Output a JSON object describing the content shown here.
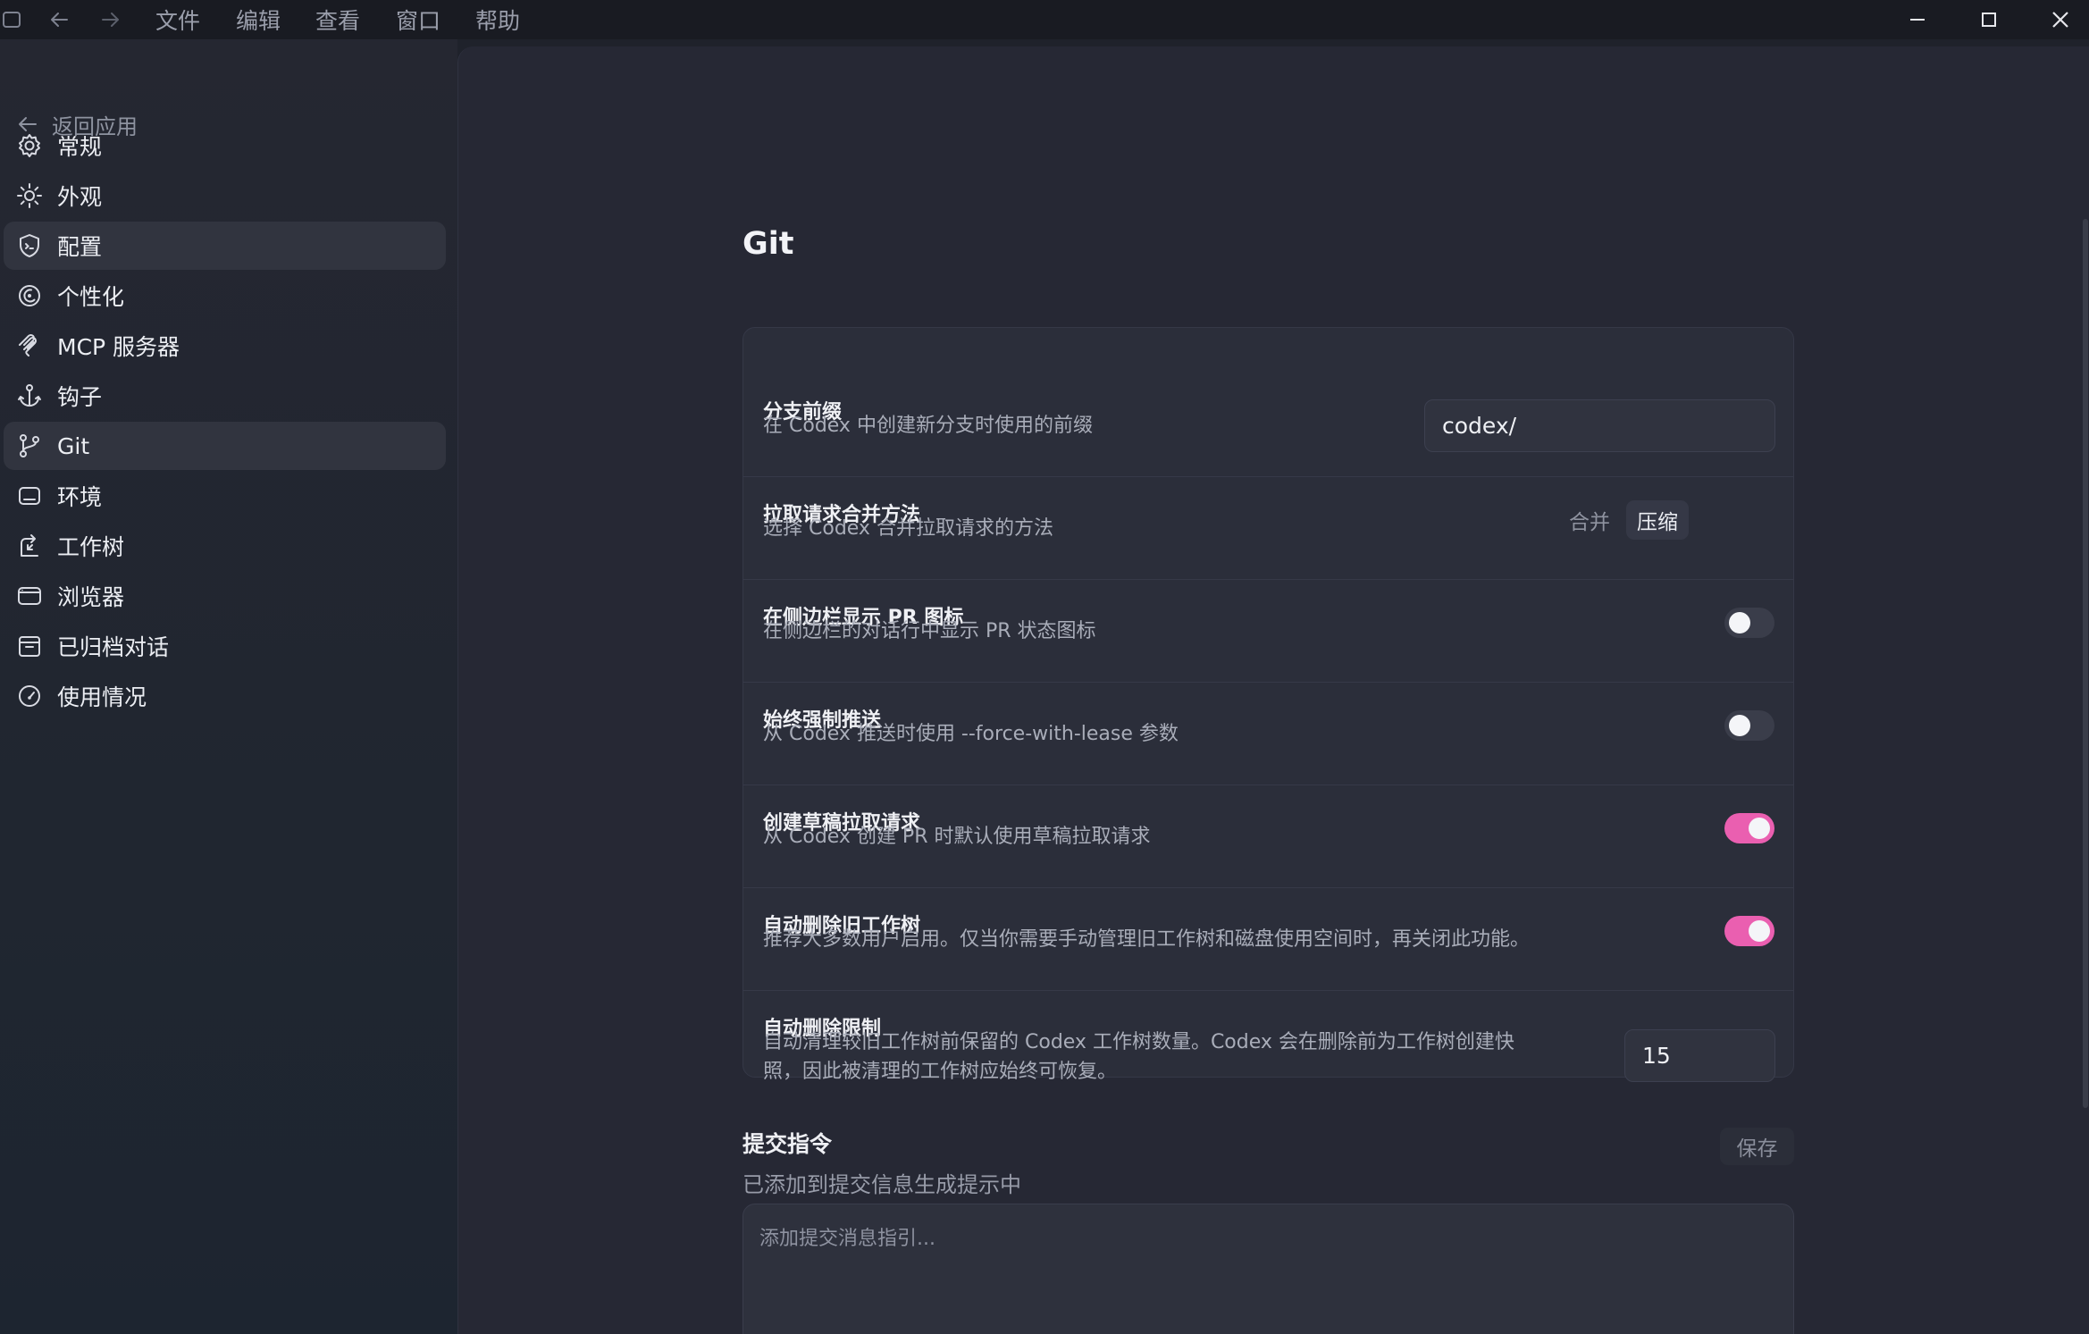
{
  "titlebar": {
    "menus": [
      "文件",
      "编辑",
      "查看",
      "窗口",
      "帮助"
    ]
  },
  "sidebar": {
    "back_label": "返回应用",
    "items": [
      {
        "label": "常规",
        "icon": "gear-icon"
      },
      {
        "label": "外观",
        "icon": "sun-icon"
      },
      {
        "label": "配置",
        "icon": "shield-icon"
      },
      {
        "label": "个性化",
        "icon": "personalize-icon"
      },
      {
        "label": "MCP 服务器",
        "icon": "mcp-icon"
      },
      {
        "label": "钩子",
        "icon": "anchor-icon"
      },
      {
        "label": "Git",
        "icon": "git-branch-icon"
      },
      {
        "label": "环境",
        "icon": "environment-icon"
      },
      {
        "label": "工作树",
        "icon": "worktree-icon"
      },
      {
        "label": "浏览器",
        "icon": "browser-icon"
      },
      {
        "label": "已归档对话",
        "icon": "archive-icon"
      },
      {
        "label": "使用情况",
        "icon": "gauge-icon"
      }
    ],
    "active_items": [
      "配置",
      "Git"
    ]
  },
  "main": {
    "title": "Git",
    "settings": {
      "branch_prefix": {
        "title": "分支前缀",
        "desc": "在 Codex 中创建新分支时使用的前缀",
        "value": "codex/"
      },
      "merge_method": {
        "title": "拉取请求合并方法",
        "desc": "选择 Codex 合并拉取请求的方法",
        "options": [
          "合并",
          "压缩"
        ],
        "selected": "压缩"
      },
      "show_pr_icon": {
        "title": "在侧边栏显示 PR 图标",
        "desc": "在侧边栏的对话行中显示 PR 状态图标",
        "enabled": false
      },
      "force_push": {
        "title": "始终强制推送",
        "desc": "从 Codex 推送时使用 --force-with-lease 参数",
        "enabled": false
      },
      "draft_pr": {
        "title": "创建草稿拉取请求",
        "desc": "从 Codex 创建 PR 时默认使用草稿拉取请求",
        "enabled": true
      },
      "auto_delete": {
        "title": "自动删除旧工作树",
        "desc": "推荐大多数用户启用。仅当你需要手动管理旧工作树和磁盘使用空间时，再关闭此功能。",
        "enabled": true
      },
      "auto_delete_limit": {
        "title": "自动删除限制",
        "desc_line1": "自动清理较旧工作树前保留的 Codex 工作树数量。Codex 会在删除前为工作树创建快",
        "desc_line2": "照，因此被清理的工作树应始终可恢复。",
        "value": "15"
      }
    },
    "commit_instructions": {
      "title": "提交指令",
      "desc": "已添加到提交信息生成提示中",
      "save_label": "保存",
      "placeholder": "添加提交消息指引..."
    }
  },
  "colors": {
    "accent_toggle": "#ea5fb0",
    "background": "#262834",
    "sidebar": "#22252f"
  }
}
